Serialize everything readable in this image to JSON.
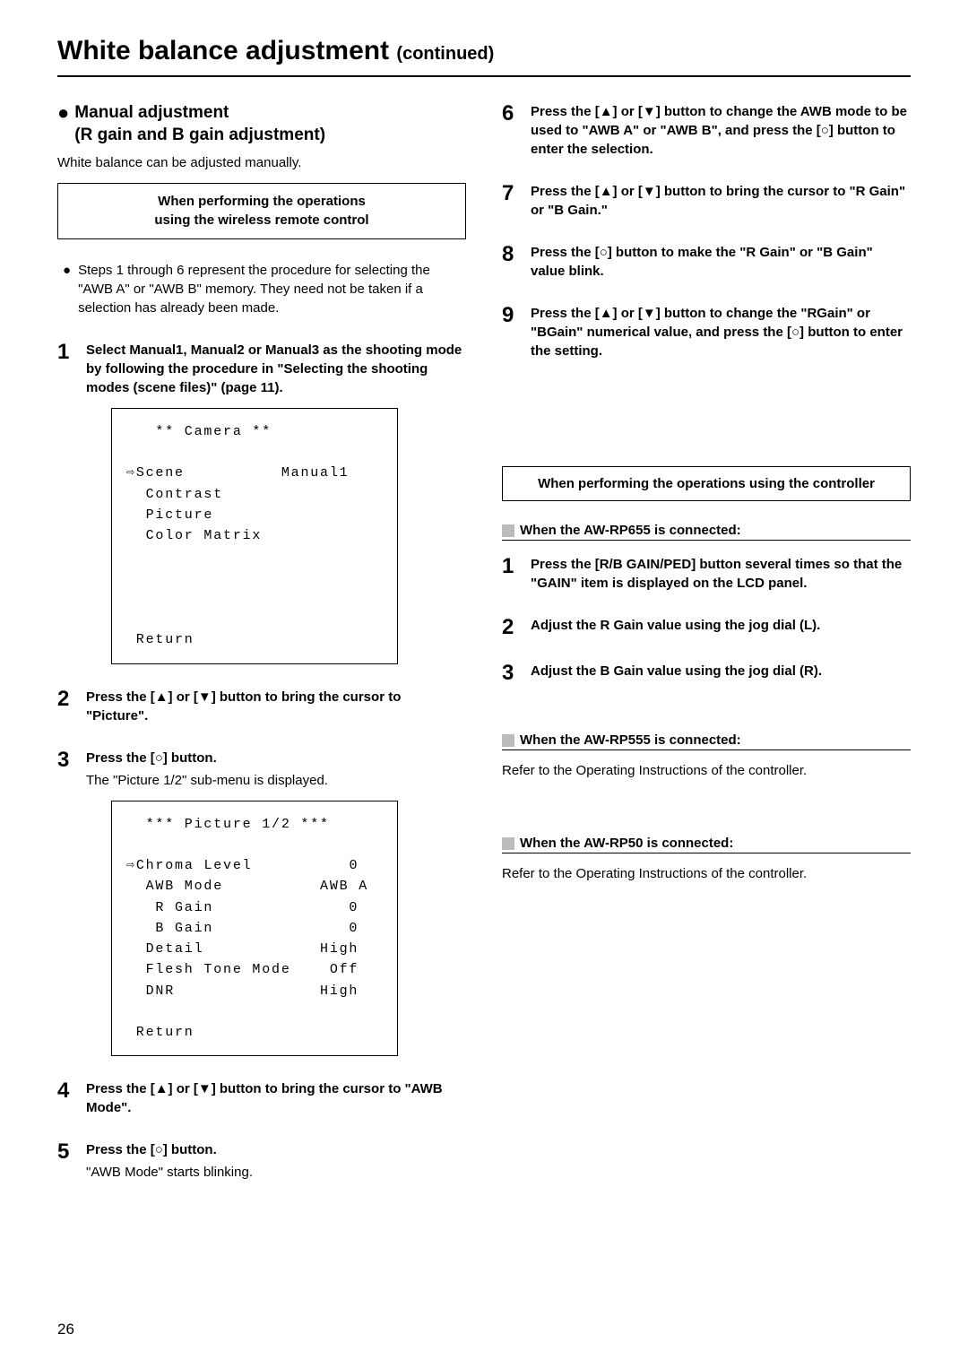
{
  "title": {
    "main": "White balance adjustment",
    "continued": "(continued)"
  },
  "left": {
    "section_head_l1": "Manual adjustment",
    "section_head_l2": "(R gain and B gain adjustment)",
    "intro": "White balance can be adjusted manually.",
    "box_l1": "When performing the operations",
    "box_l2": "using the wireless remote control",
    "note": "Steps 1 through 6 represent the procedure for selecting the \"AWB A\" or \"AWB B\" memory. They need not be taken if a selection has already been made.",
    "step1": "Select Manual1, Manual2 or Manual3 as the shooting mode by following the procedure in \"Selecting the shooting modes (scene files)\" (page 11).",
    "screen1": "   ** Camera **\n\n⇨Scene          Manual1\n  Contrast\n  Picture\n  Color Matrix\n\n\n\n\n Return",
    "step2": "Press the [▲] or [▼] button to bring the cursor to \"Picture\".",
    "step3_bold": "Press the [○] button.",
    "step3_reg": "The \"Picture 1/2\" sub-menu is displayed.",
    "screen2": "  *** Picture 1/2 ***\n\n⇨Chroma Level          0\n  AWB Mode          AWB A\n   R Gain              0\n   B Gain              0\n  Detail            High\n  Flesh Tone Mode    Off\n  DNR               High\n\n Return",
    "step4": "Press the [▲] or [▼] button to bring the cursor to \"AWB Mode\".",
    "step5_bold": "Press the [○] button.",
    "step5_reg": "\"AWB Mode\" starts blinking."
  },
  "right": {
    "step6": "Press the [▲] or [▼] button to change the AWB mode to be used to \"AWB A\" or \"AWB B\", and press the [○] button to enter the selection.",
    "step7": "Press the [▲] or [▼] button to bring the cursor to \"R Gain\" or \"B Gain.\"",
    "step8": "Press the [○] button to make the \"R Gain\" or \"B Gain\" value blink.",
    "step9": "Press the [▲] or [▼] button to change the \"RGain\" or \"BGain\" numerical value, and press the [○] button to enter the setting.",
    "box": "When performing the operations using the controller",
    "sub1_head": "When the AW-RP655 is connected:",
    "sub1_step1": "Press the [R/B GAIN/PED] button several times so that the \"GAIN\" item is displayed on the LCD panel.",
    "sub1_step2": "Adjust the R Gain value using the jog dial (L).",
    "sub1_step3": "Adjust the B Gain value using the jog dial (R).",
    "sub2_head": "When the AW-RP555 is connected:",
    "sub2_body": "Refer to the Operating Instructions of the controller.",
    "sub3_head": "When the AW-RP50 is connected:",
    "sub3_body": "Refer to the Operating Instructions of the controller."
  },
  "page_number": "26"
}
